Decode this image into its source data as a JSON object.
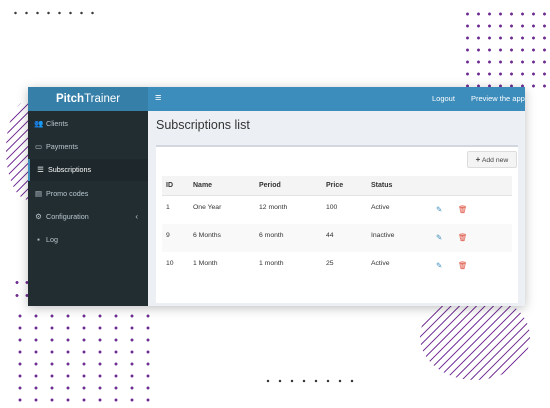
{
  "colors": {
    "topbar": "#3c8dbc",
    "sidebar": "#222d32",
    "content_bg": "#ecf0f5",
    "decor": "#6f2c91"
  },
  "brand": {
    "bold": "Pitch",
    "regular": "Trainer"
  },
  "topbar": {
    "menu_icon": "hamburger-icon",
    "menu_glyph": "≡",
    "logout": "Logout",
    "preview": "Preview the app"
  },
  "sidebar": {
    "items": [
      {
        "label": "Clients",
        "icon": "users-icon",
        "glyph": "👥",
        "active": false
      },
      {
        "label": "Payments",
        "icon": "money-icon",
        "glyph": "▭",
        "active": false
      },
      {
        "label": "Subscriptions",
        "icon": "list-icon",
        "glyph": "☰",
        "active": true
      },
      {
        "label": "Promo codes",
        "icon": "barcode-icon",
        "glyph": "▤",
        "active": false
      },
      {
        "label": "Configuration",
        "icon": "cogs-icon",
        "glyph": "⚙",
        "active": false,
        "chevron": "‹"
      },
      {
        "label": "Log",
        "icon": "file-icon",
        "glyph": "▪",
        "active": false
      }
    ]
  },
  "main": {
    "title": "Subscriptions list",
    "add_button": {
      "icon": "plus",
      "label": "Add new"
    },
    "table": {
      "columns": [
        "ID",
        "Name",
        "Period",
        "Price",
        "Status"
      ],
      "rows": [
        {
          "id": "1",
          "name": "One Year",
          "period": "12 month",
          "price": "100",
          "status": "Active"
        },
        {
          "id": "9",
          "name": "6 Months",
          "period": "6 month",
          "price": "44",
          "status": "Inactive"
        },
        {
          "id": "10",
          "name": "1 Month",
          "period": "1 month",
          "price": "25",
          "status": "Active"
        }
      ],
      "edit_glyph": "✎",
      "delete_glyph": "🗑"
    }
  }
}
